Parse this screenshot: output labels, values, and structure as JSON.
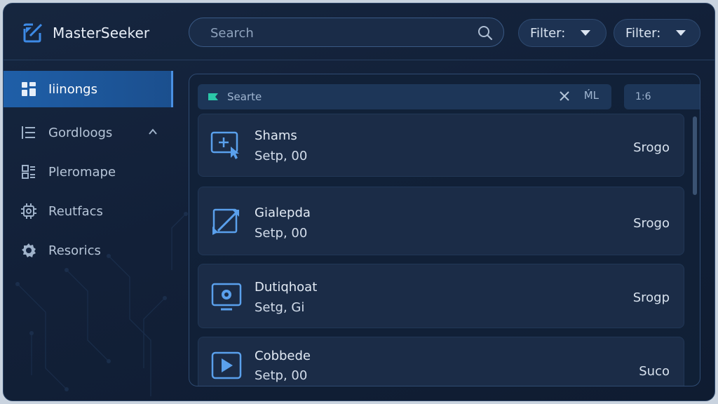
{
  "app": {
    "name": "MasterSeeker"
  },
  "search": {
    "placeholder": "Search"
  },
  "filters": [
    {
      "label": "Filter:"
    },
    {
      "label": "Filter:"
    }
  ],
  "sidebar": {
    "items": [
      {
        "label": "Iiinongs",
        "icon": "grid-icon",
        "active": true
      },
      {
        "label": "Gordloogs",
        "icon": "list-icon",
        "expanded": true
      },
      {
        "label": "Pleromape",
        "icon": "layout-icon"
      },
      {
        "label": "Reutfacs",
        "icon": "chip-icon"
      },
      {
        "label": "Resorics",
        "icon": "gear-icon"
      }
    ]
  },
  "panel": {
    "subsearch": {
      "text": "Searte",
      "ai_label": "ḾL"
    },
    "counter": "1:6",
    "results": [
      {
        "title": "Shams",
        "subtitle": "Setp, 00",
        "status": "Srogo",
        "icon": "add-select-icon"
      },
      {
        "title": "Gialepda",
        "subtitle": "Setp, 00",
        "status": "Srogo",
        "icon": "resize-arrow-icon"
      },
      {
        "title": "Dutiqhoat",
        "subtitle": "Setg, Gi",
        "status": "Srogp",
        "icon": "monitor-gear-icon"
      },
      {
        "title": "Cobbede",
        "subtitle": "Setp, 00",
        "status": "Suco",
        "icon": "play-icon"
      }
    ]
  },
  "colors": {
    "accent": "#1f5fa8",
    "background": "#122038",
    "card": "#1b2c47"
  }
}
